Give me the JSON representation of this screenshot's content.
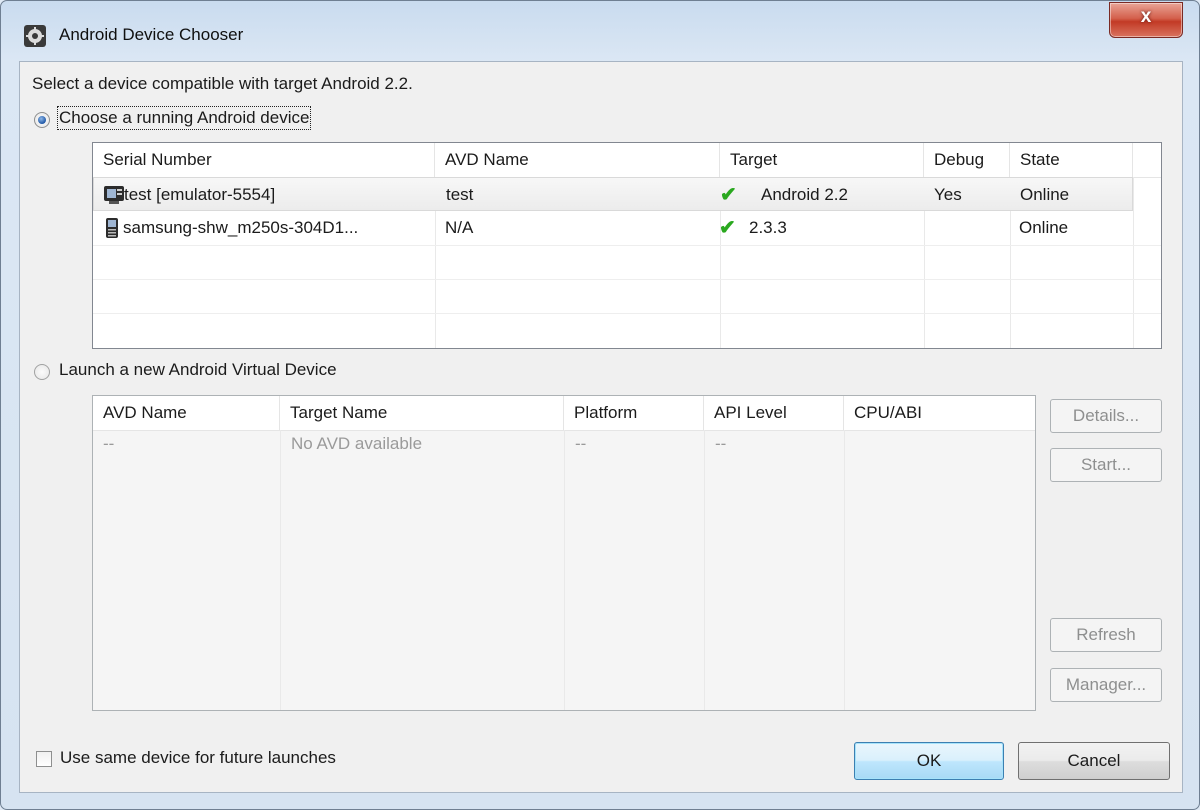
{
  "window": {
    "title": "Android Device Chooser",
    "close_label": "x"
  },
  "prompt": "Select a device compatible with target Android 2.2.",
  "running": {
    "radio_label": "Choose a running Android device",
    "columns": [
      "Serial Number",
      "AVD Name",
      "Target",
      "Debug",
      "State"
    ],
    "rows": [
      {
        "serial": "test [emulator-5554]",
        "avd": "test",
        "target": "Android 2.2",
        "debug": "Yes",
        "state": "Online",
        "icon": "emulator-icon"
      },
      {
        "serial": "samsung-shw_m250s-304D1...",
        "avd": "N/A",
        "target": "2.3.3",
        "debug": "",
        "state": "Online",
        "icon": "phone-icon"
      }
    ]
  },
  "launch": {
    "radio_label": "Launch a new Android Virtual Device",
    "columns": [
      "AVD Name",
      "Target Name",
      "Platform",
      "API Level",
      "CPU/ABI"
    ],
    "row": {
      "avd": "--",
      "target": "No AVD available",
      "platform": "--",
      "api": "--"
    },
    "buttons": {
      "details": "Details...",
      "start": "Start...",
      "refresh": "Refresh",
      "manager": "Manager..."
    }
  },
  "footer": {
    "checkbox_label": "Use same device for future launches",
    "ok": "OK",
    "cancel": "Cancel"
  },
  "colors": {
    "check": "#2aa81f",
    "close": "#c23a25"
  }
}
